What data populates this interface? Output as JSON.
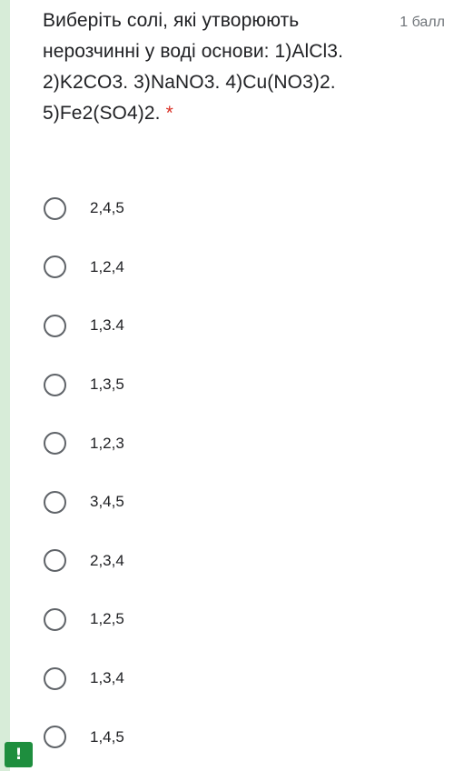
{
  "question": {
    "text": "Виберіть солі, які утворюють нерозчинні у воді основи: 1)AlCl3. 2)K2CO3. 3)NaNO3. 4)Cu(NO3)2. 5)Fe2(SO4)2.",
    "required_marker": "*",
    "points": "1 балл"
  },
  "options": [
    {
      "label": "2,4,5"
    },
    {
      "label": "1,2,4"
    },
    {
      "label": "1,3.4"
    },
    {
      "label": "1,3,5"
    },
    {
      "label": "1,2,3"
    },
    {
      "label": "3,4,5"
    },
    {
      "label": "2,3,4"
    },
    {
      "label": "1,2,5"
    },
    {
      "label": "1,3,4"
    },
    {
      "label": "1,4,5"
    }
  ],
  "report_button": {
    "glyph": "!"
  },
  "colors": {
    "accent_bar": "#d7ecd8",
    "required": "#d93025",
    "report_button": "#1e8e3e",
    "radio_border": "#5f6368"
  },
  "icons": {
    "radio": "radio-unselected-icon",
    "report": "exclamation-icon"
  }
}
